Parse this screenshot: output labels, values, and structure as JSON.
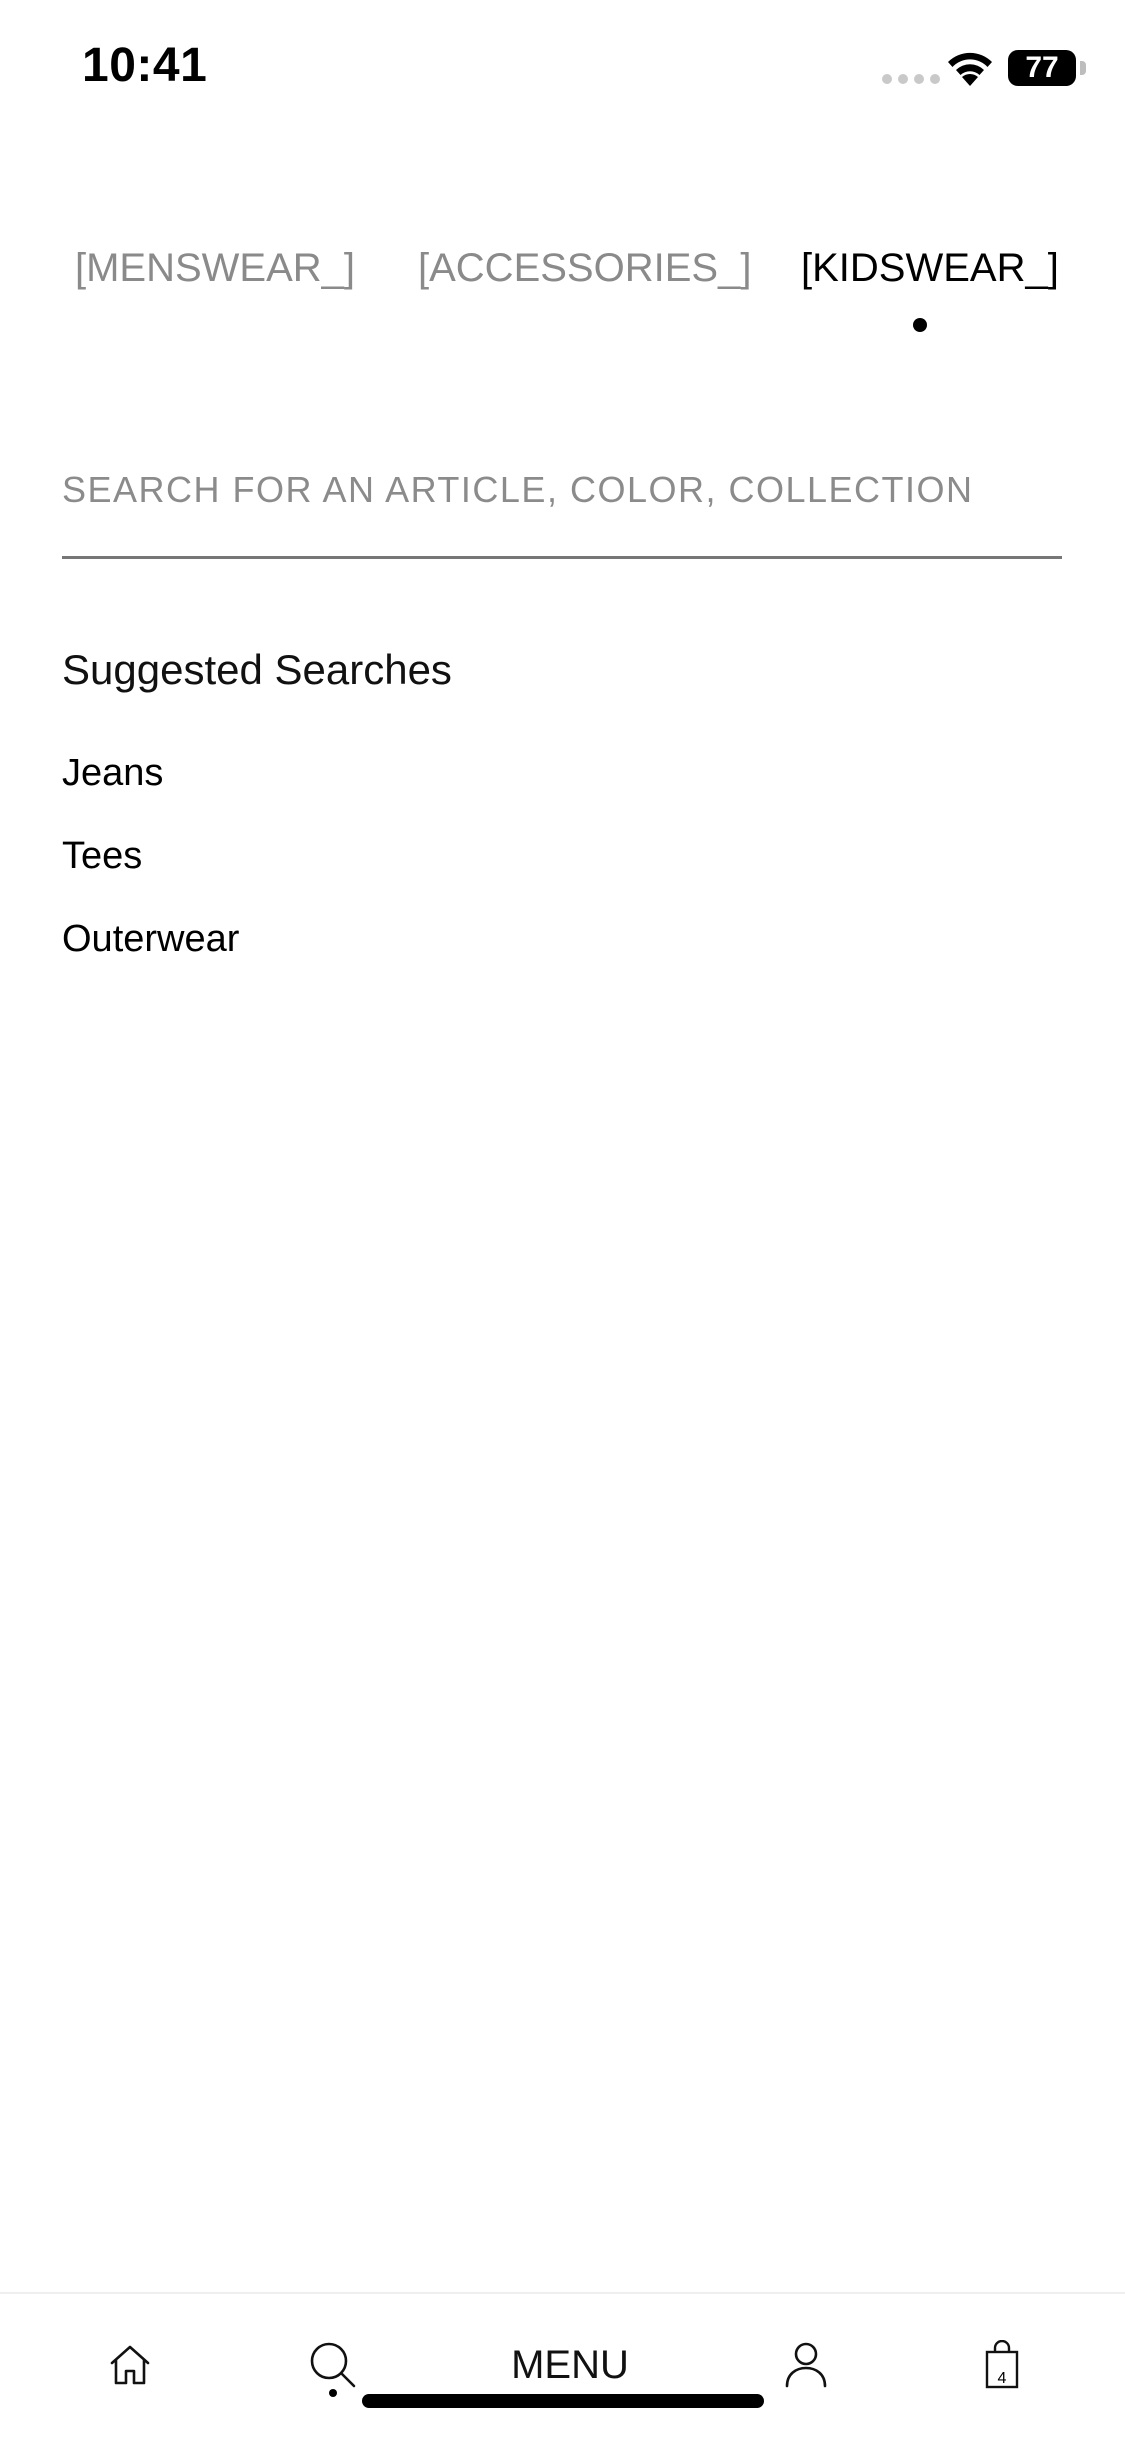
{
  "status_bar": {
    "time": "10:41",
    "battery": "77"
  },
  "tabs": [
    {
      "label": "[MENSWEAR_]",
      "active": false
    },
    {
      "label": "[ACCESSORIES_]",
      "active": false
    },
    {
      "label": "[KIDSWEAR_]",
      "active": true
    }
  ],
  "search": {
    "placeholder": "SEARCH FOR AN ARTICLE, COLOR, COLLECTION",
    "value": ""
  },
  "suggested": {
    "title": "Suggested Searches",
    "items": [
      "Jeans",
      "Tees",
      "Outerwear"
    ]
  },
  "bottom_nav": {
    "home_icon": "home-icon",
    "search_icon": "search-icon",
    "menu_label": "MENU",
    "account_icon": "person-icon",
    "bag_icon": "shopping-bag-icon",
    "bag_count": "4"
  }
}
